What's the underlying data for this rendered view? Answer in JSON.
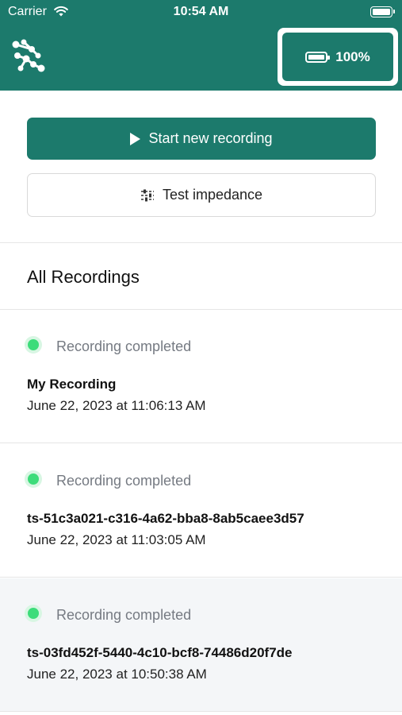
{
  "status_bar": {
    "carrier": "Carrier",
    "time": "10:54 AM"
  },
  "header": {
    "battery_label": "100%"
  },
  "actions": {
    "start_label": "Start new recording",
    "impedance_label": "Test impedance"
  },
  "recordings_title": "All Recordings",
  "recordings": [
    {
      "status": "Recording completed",
      "name": "My Recording",
      "date": "June 22, 2023 at 11:06:13 AM"
    },
    {
      "status": "Recording completed",
      "name": "ts-51c3a021-c316-4a62-bba8-8ab5caee3d57",
      "date": "June 22, 2023 at 11:03:05 AM"
    },
    {
      "status": "Recording completed",
      "name": "ts-03fd452f-5440-4c10-bcf8-74486d20f7de",
      "date": "June 22, 2023 at 10:50:38 AM"
    }
  ],
  "colors": {
    "brand": "#1c7a6c",
    "status_dot": "#3ddc7a"
  }
}
